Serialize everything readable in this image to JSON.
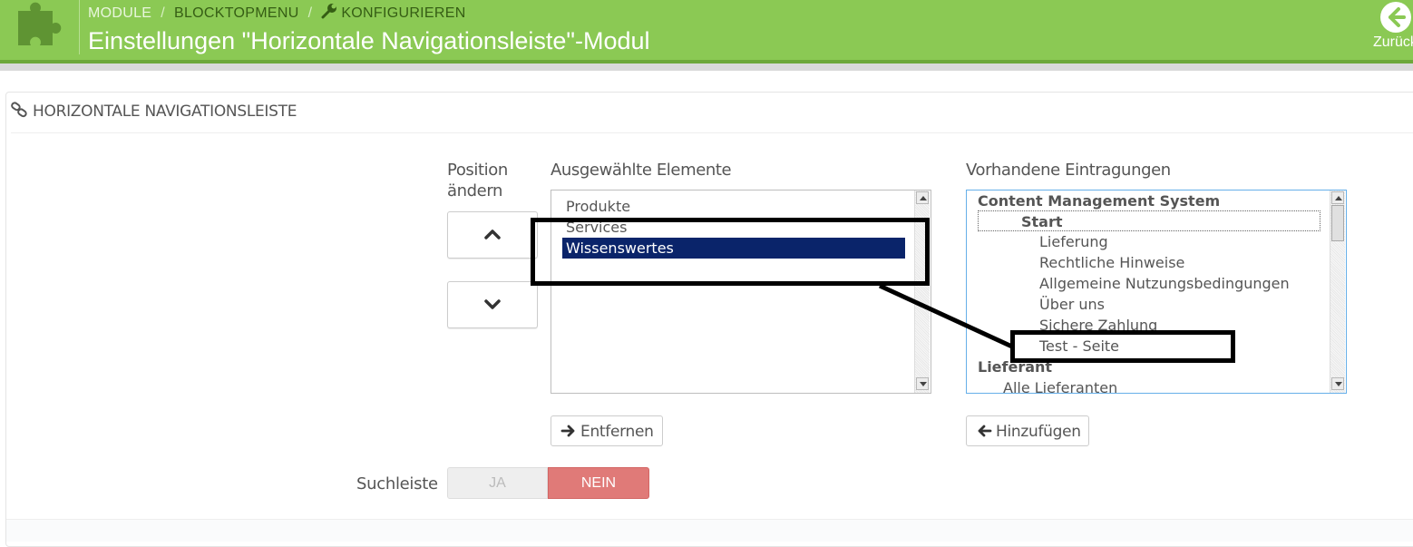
{
  "header": {
    "breadcrumb": [
      "MODULE",
      "BLOCKTOPMENU",
      "KONFIGURIEREN"
    ],
    "breadcrumb_separator": "/",
    "title": "Einstellungen \"Horizontale Navigationsleiste\"-Modul",
    "back_label": "Zurück",
    "colors": {
      "header_bg": "#8bc954",
      "back_icon": "#8bc954"
    }
  },
  "panel": {
    "heading": "HORIZONTALE NAVIGATIONSLEISTE",
    "position_label": "Position ändern",
    "selected_label": "Ausgewählte Elemente",
    "available_label": "Vorhandene Eintragungen",
    "selected_items": [
      "Produkte",
      "Services",
      "Wissenswertes"
    ],
    "selected_active": "Wissenswertes",
    "available_items": {
      "group_cms": "Content Management System",
      "start": "Start",
      "lieferung": "Lieferung",
      "rechtliche": "Rechtliche Hinweise",
      "agb": "Allgemeine Nutzungsbedingungen",
      "ueber": "Über uns",
      "sichere": "Sichere Zahlung",
      "test": "Test - Seite",
      "group_lieferant": "Lieferant",
      "alle_lieferanten": "Alle Lieferanten"
    },
    "remove_button": "Entfernen",
    "add_button": "Hinzufügen",
    "search_label": "Suchleiste",
    "switch_yes": "JA",
    "switch_no": "NEIN",
    "switch_value": "NEIN",
    "colors": {
      "selection": "#0a246a",
      "switch_no": "#e07a78"
    }
  }
}
